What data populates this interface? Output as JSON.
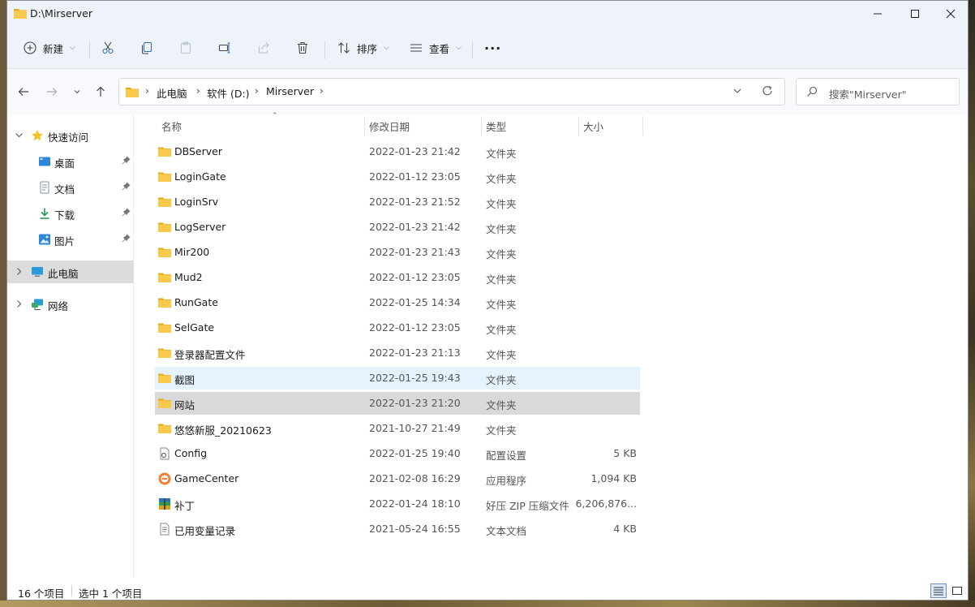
{
  "window": {
    "title": "D:\\Mirserver"
  },
  "toolbar": {
    "new_label": "新建",
    "sort_label": "排序",
    "view_label": "查看",
    "more": "···"
  },
  "nav": {
    "breadcrumbs": [
      "此电脑",
      "软件 (D:)",
      "Mirserver"
    ],
    "search_placeholder": "搜索\"Mirserver\""
  },
  "sidebar": {
    "quick_access": "快速访问",
    "items": [
      {
        "label": "桌面",
        "icon": "desktop-icon"
      },
      {
        "label": "文档",
        "icon": "document-icon"
      },
      {
        "label": "下载",
        "icon": "download-icon"
      },
      {
        "label": "图片",
        "icon": "pictures-icon"
      }
    ],
    "this_pc": "此电脑",
    "network": "网络"
  },
  "columns": {
    "name": "名称",
    "date": "修改日期",
    "type": "类型",
    "size": "大小"
  },
  "files": [
    {
      "name": "DBServer",
      "date": "2022-01-23 21:42",
      "type": "文件夹",
      "size": "",
      "icon": "folder-icon"
    },
    {
      "name": "LoginGate",
      "date": "2022-01-12 23:05",
      "type": "文件夹",
      "size": "",
      "icon": "folder-icon"
    },
    {
      "name": "LoginSrv",
      "date": "2022-01-23 21:52",
      "type": "文件夹",
      "size": "",
      "icon": "folder-icon"
    },
    {
      "name": "LogServer",
      "date": "2022-01-23 21:42",
      "type": "文件夹",
      "size": "",
      "icon": "folder-icon"
    },
    {
      "name": "Mir200",
      "date": "2022-01-23 21:43",
      "type": "文件夹",
      "size": "",
      "icon": "folder-icon"
    },
    {
      "name": "Mud2",
      "date": "2022-01-12 23:05",
      "type": "文件夹",
      "size": "",
      "icon": "folder-icon"
    },
    {
      "name": "RunGate",
      "date": "2022-01-25 14:34",
      "type": "文件夹",
      "size": "",
      "icon": "folder-icon"
    },
    {
      "name": "SelGate",
      "date": "2022-01-12 23:05",
      "type": "文件夹",
      "size": "",
      "icon": "folder-icon"
    },
    {
      "name": "登录器配置文件",
      "date": "2022-01-23 21:13",
      "type": "文件夹",
      "size": "",
      "icon": "folder-icon"
    },
    {
      "name": "截图",
      "date": "2022-01-25 19:43",
      "type": "文件夹",
      "size": "",
      "icon": "folder-icon"
    },
    {
      "name": "网站",
      "date": "2022-01-23 21:20",
      "type": "文件夹",
      "size": "",
      "icon": "folder-icon"
    },
    {
      "name": "悠悠新服_20210623",
      "date": "2021-10-27 21:49",
      "type": "文件夹",
      "size": "",
      "icon": "folder-icon"
    },
    {
      "name": "Config",
      "date": "2022-01-25 19:40",
      "type": "配置设置",
      "size": "5 KB",
      "icon": "config-file-icon"
    },
    {
      "name": "GameCenter",
      "date": "2021-02-08 16:29",
      "type": "应用程序",
      "size": "1,094 KB",
      "icon": "app-icon"
    },
    {
      "name": "补丁",
      "date": "2022-01-24 18:10",
      "type": "好压 ZIP 压缩文件",
      "size": "6,206,876...",
      "icon": "zip-archive-icon"
    },
    {
      "name": "已用变量记录",
      "date": "2021-05-24 16:55",
      "type": "文本文档",
      "size": "4 KB",
      "icon": "text-file-icon"
    }
  ],
  "status": {
    "count": "16 个项目",
    "selected": "选中 1 个项目"
  },
  "colors": {
    "chrome": "#eef3f9",
    "hover": "#e5f3ff",
    "selected": "#d9d9d9",
    "folder": "#f5c342"
  }
}
